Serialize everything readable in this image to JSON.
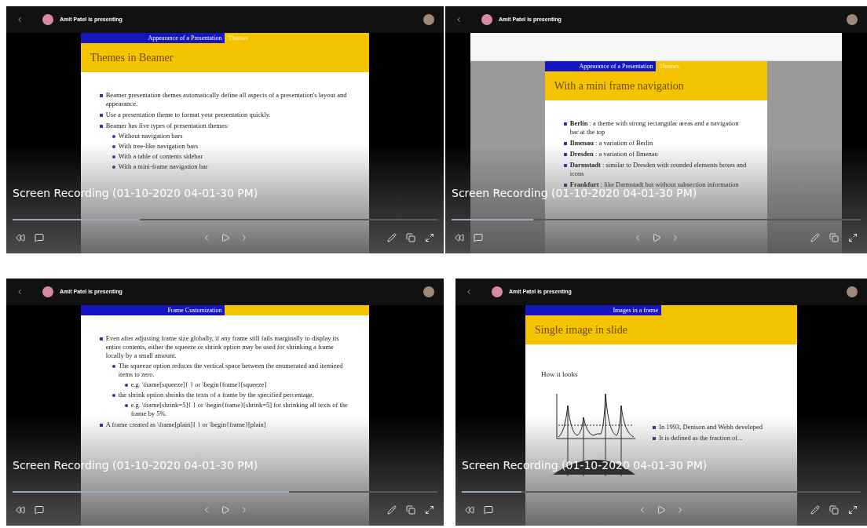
{
  "panels": [
    {
      "presenter": "Amit Patel is presenting",
      "viewer": false,
      "caption": "Screen Recording (01-10-2020 04-01-30 PM)",
      "progress": {
        "level": 0.3
      },
      "slide": {
        "kind": "list",
        "section": "Appearance of a Presentation",
        "subsection": "Themes",
        "title": "Themes in Beamer",
        "items": [
          {
            "text": "Beamer presentation themes automatically define all aspects of a presentation's layout and appearance."
          },
          {
            "text": "Use a presentation theme to format your presentation quickly."
          },
          {
            "text": "Beamer has five types of presentation themes:",
            "children": [
              {
                "text": "Without navigation bars"
              },
              {
                "text": "With tree-like navigation bars"
              },
              {
                "text": "With a table of contents sidebar"
              },
              {
                "text": "With a mini-frame navigation bar"
              }
            ]
          }
        ]
      }
    },
    {
      "presenter": "Amit Patel is presenting",
      "viewer": true,
      "caption": "Screen Recording (01-10-2020 04-01-30 PM)",
      "progress": {
        "level": 0.2
      },
      "slide": {
        "kind": "list",
        "section": "Appearance of a Presentation",
        "subsection": "Themes",
        "title": "With a mini frame navigation",
        "items": [
          {
            "text": "**Berlin** : a theme with strong rectangular areas and a navigation bar at the top"
          },
          {
            "text": "**Ilmenau** : a variation of Berlin"
          },
          {
            "text": "**Dresden** : a variation of Ilmenau"
          },
          {
            "text": "**Darmstadt** : similar to Dresden with rounded elements boxes and icons"
          },
          {
            "text": "**Frankfurt** : like Darmstadt but without subsection information"
          }
        ]
      }
    },
    {
      "presenter": "Amit Patel is presenting",
      "viewer": false,
      "caption": "Screen Recording (01-10-2020 04-01-30 PM)",
      "progress": {
        "level": 0.65
      },
      "slide": {
        "kind": "list",
        "section": "Frame Customization",
        "items": [
          {
            "text": "Even after adjusting frame size globally, if any frame still fails marginally to display its entire contents, either the squeeze or shrink option may be used for shrinking a frame locally by a small amount.",
            "children": [
              {
                "text": "The squeeze option reduces the vertical space between the enumerated and itemized items to zero.",
                "children": [
                  {
                    "text": "e.g. \\frame[squeeze]{ } or \\begin{frame}[squeeze]"
                  }
                ]
              },
              {
                "text": "the shrink option shrinks the texts of a frame by the specified percentage.",
                "children": [
                  {
                    "text": "e.g. \\frame[shrink=5]{ } or \\begin{frame}[shrink=5] for shrinking all texts of the frame by 5%."
                  }
                ]
              }
            ]
          },
          {
            "text": "A frame created as \\frame[plain]{ } or \\begin{frame}[plain]"
          }
        ]
      }
    },
    {
      "presenter": "Amit Patel is presenting",
      "viewer": false,
      "caption": "Screen Recording (01-10-2020 04-01-30 PM)",
      "progress": {
        "level": 0.15
      },
      "slide": {
        "kind": "image",
        "section": "Images in a frame",
        "title": "Single image in slide",
        "lead": "How it looks",
        "items": [
          {
            "text": "In 1993, Denison and Webb developed"
          },
          {
            "text": "It is defined as the fraction of..."
          }
        ]
      }
    }
  ]
}
